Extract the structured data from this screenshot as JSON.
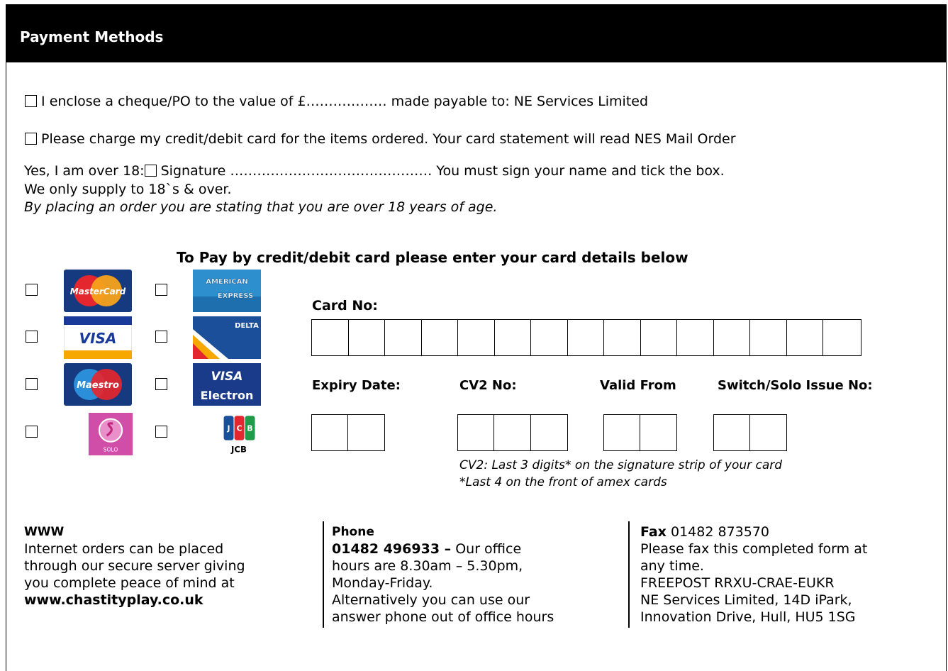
{
  "header": {
    "title": "Payment Methods"
  },
  "options": {
    "cheque": "I enclose a cheque/PO to the value of £……………… made payable to: NE Services Limited",
    "card": "Please charge my credit/debit card for the items ordered. Your card statement will read NES Mail Order"
  },
  "age": {
    "prefix": "Yes, I am over 18:",
    "signature": "Signature ……………………………………… You must sign your name and tick the box.",
    "supply": "We only supply to 18`s & over.",
    "notice": "By placing an order you are stating that you are over 18 years of age."
  },
  "card_section": {
    "heading": "To Pay by credit/debit card please enter your card details below",
    "card_no_label": "Card No:",
    "card_no_boxes": 15,
    "fields": [
      {
        "label": "Expiry Date:",
        "boxes": 2
      },
      {
        "label": "CV2 No:",
        "boxes": 3
      },
      {
        "label": "Valid From",
        "boxes": 2
      },
      {
        "label": "Switch/Solo Issue No:",
        "boxes": 2
      }
    ],
    "cv2_note_1": "CV2: Last 3 digits* on the signature strip of your card",
    "cv2_note_2": "*Last 4 on the front of amex cards"
  },
  "card_logos": [
    {
      "name": "MasterCard",
      "text": "MasterCard",
      "color": "#1a3a7a"
    },
    {
      "name": "American Express",
      "text": "AMERICAN EXPRESS",
      "color": "#2b8fd0"
    },
    {
      "name": "Visa",
      "text": "VISA",
      "color": "#1a3a9a"
    },
    {
      "name": "Delta",
      "text": "DELTA",
      "color": "#1b4f9a"
    },
    {
      "name": "Maestro",
      "text": "Maestro",
      "color": "#1a3a7a"
    },
    {
      "name": "Visa Electron",
      "text1": "VISA",
      "text2": "Electron",
      "color": "#1a3a8a"
    },
    {
      "name": "Solo",
      "text": "SOLO",
      "color": "#d14fa6"
    },
    {
      "name": "JCB",
      "text": "JCB",
      "color": "#ffffff"
    }
  ],
  "footer": {
    "www": {
      "heading": "WWW",
      "lines": [
        "Internet orders can be placed",
        "through our secure server giving",
        "you complete peace of mind at"
      ],
      "url": "www.chastityplay.co.uk"
    },
    "phone": {
      "heading": "Phone",
      "number": "01482 496933 –",
      "lines_after": " Our office",
      "lines": [
        "hours are 8.30am – 5.30pm,",
        "Monday-Friday.",
        "Alternatively you can use our",
        "answer phone out of office hours"
      ]
    },
    "fax": {
      "heading": "Fax",
      "number": " 01482 873570",
      "lines": [
        "Please fax this completed form at",
        "any time.",
        "FREEPOST RRXU-CRAE-EUKR",
        "NE Services Limited, 14D iPark,",
        "Innovation Drive, Hull, HU5 1SG"
      ]
    }
  }
}
